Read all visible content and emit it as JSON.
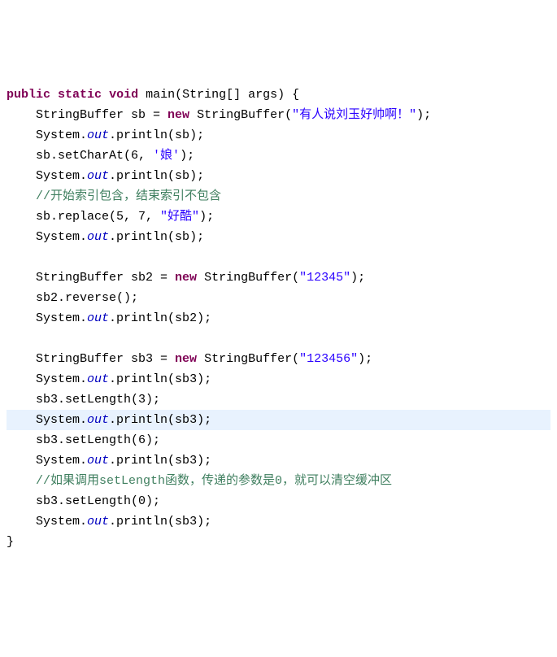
{
  "lines": [
    {
      "indent": 0,
      "tokens": [
        {
          "cls": "kw",
          "t": "public"
        },
        {
          "cls": "plain",
          "t": " "
        },
        {
          "cls": "kw",
          "t": "static"
        },
        {
          "cls": "plain",
          "t": " "
        },
        {
          "cls": "kw",
          "t": "void"
        },
        {
          "cls": "plain",
          "t": " main(String[] args) {"
        }
      ]
    },
    {
      "indent": 1,
      "tokens": [
        {
          "cls": "plain",
          "t": "StringBuffer sb = "
        },
        {
          "cls": "kw",
          "t": "new"
        },
        {
          "cls": "plain",
          "t": " StringBuffer("
        },
        {
          "cls": "str",
          "t": "\"有人说刘玉好帅啊！\""
        },
        {
          "cls": "plain",
          "t": ");"
        }
      ]
    },
    {
      "indent": 1,
      "tokens": [
        {
          "cls": "plain",
          "t": "System."
        },
        {
          "cls": "field",
          "t": "out"
        },
        {
          "cls": "plain",
          "t": ".println(sb);"
        }
      ]
    },
    {
      "indent": 1,
      "tokens": [
        {
          "cls": "plain",
          "t": "sb.setCharAt(6, "
        },
        {
          "cls": "chr",
          "t": "'娘'"
        },
        {
          "cls": "plain",
          "t": ");"
        }
      ]
    },
    {
      "indent": 1,
      "tokens": [
        {
          "cls": "plain",
          "t": "System."
        },
        {
          "cls": "field",
          "t": "out"
        },
        {
          "cls": "plain",
          "t": ".println(sb);"
        }
      ]
    },
    {
      "indent": 1,
      "tokens": [
        {
          "cls": "comment",
          "t": "//开始索引包含，结束索引不包含"
        }
      ]
    },
    {
      "indent": 1,
      "tokens": [
        {
          "cls": "plain",
          "t": "sb.replace(5, 7, "
        },
        {
          "cls": "str",
          "t": "\"好酷\""
        },
        {
          "cls": "plain",
          "t": ");"
        }
      ]
    },
    {
      "indent": 1,
      "tokens": [
        {
          "cls": "plain",
          "t": "System."
        },
        {
          "cls": "field",
          "t": "out"
        },
        {
          "cls": "plain",
          "t": ".println(sb);"
        }
      ]
    },
    {
      "indent": 1,
      "tokens": []
    },
    {
      "indent": 1,
      "tokens": [
        {
          "cls": "plain",
          "t": "StringBuffer sb2 = "
        },
        {
          "cls": "kw",
          "t": "new"
        },
        {
          "cls": "plain",
          "t": " StringBuffer("
        },
        {
          "cls": "str",
          "t": "\"12345\""
        },
        {
          "cls": "plain",
          "t": ");"
        }
      ]
    },
    {
      "indent": 1,
      "tokens": [
        {
          "cls": "plain",
          "t": "sb2.reverse();"
        }
      ]
    },
    {
      "indent": 1,
      "tokens": [
        {
          "cls": "plain",
          "t": "System."
        },
        {
          "cls": "field",
          "t": "out"
        },
        {
          "cls": "plain",
          "t": ".println(sb2);"
        }
      ]
    },
    {
      "indent": 1,
      "tokens": []
    },
    {
      "indent": 1,
      "tokens": [
        {
          "cls": "plain",
          "t": "StringBuffer sb3 = "
        },
        {
          "cls": "kw",
          "t": "new"
        },
        {
          "cls": "plain",
          "t": " StringBuffer("
        },
        {
          "cls": "str",
          "t": "\"123456\""
        },
        {
          "cls": "plain",
          "t": ");"
        }
      ]
    },
    {
      "indent": 1,
      "tokens": [
        {
          "cls": "plain",
          "t": "System."
        },
        {
          "cls": "field",
          "t": "out"
        },
        {
          "cls": "plain",
          "t": ".println(sb3);"
        }
      ]
    },
    {
      "indent": 1,
      "tokens": [
        {
          "cls": "plain",
          "t": "sb3.setLength(3);"
        }
      ]
    },
    {
      "indent": 1,
      "highlight": true,
      "tokens": [
        {
          "cls": "plain",
          "t": "System."
        },
        {
          "cls": "field",
          "t": "out"
        },
        {
          "cls": "plain",
          "t": ".println(sb3);"
        }
      ]
    },
    {
      "indent": 1,
      "tokens": [
        {
          "cls": "plain",
          "t": "sb3.setLength(6);"
        }
      ]
    },
    {
      "indent": 1,
      "tokens": [
        {
          "cls": "plain",
          "t": "System."
        },
        {
          "cls": "field",
          "t": "out"
        },
        {
          "cls": "plain",
          "t": ".println(sb3);"
        }
      ]
    },
    {
      "indent": 1,
      "tokens": [
        {
          "cls": "comment",
          "t": "//如果调用setLength函数，传递的参数是0，就可以清空缓冲区"
        }
      ]
    },
    {
      "indent": 1,
      "tokens": [
        {
          "cls": "plain",
          "t": "sb3.setLength(0);"
        }
      ]
    },
    {
      "indent": 1,
      "tokens": [
        {
          "cls": "plain",
          "t": "System."
        },
        {
          "cls": "field",
          "t": "out"
        },
        {
          "cls": "plain",
          "t": ".println(sb3);"
        }
      ]
    },
    {
      "indent": 0,
      "tokens": [
        {
          "cls": "plain",
          "t": "}"
        }
      ]
    }
  ],
  "indent_unit": "    "
}
